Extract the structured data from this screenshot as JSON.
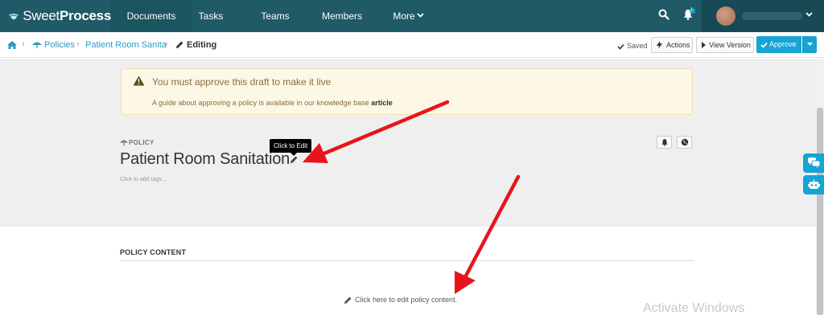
{
  "brand": {
    "sweet": "Sweet",
    "process": "Process"
  },
  "nav": {
    "documents": "Documents",
    "tasks": "Tasks",
    "teams": "Teams",
    "members": "Members",
    "more": "More",
    "notification_count": "1"
  },
  "breadcrumb": {
    "policies": "Policies",
    "document": "Patient Room Sanita",
    "current": "Editing"
  },
  "toolbar": {
    "saved": "Saved",
    "actions": "Actions",
    "view_version": "View Version",
    "approve": "Approve"
  },
  "alert": {
    "title": "You must approve this draft to make it live",
    "body": "A guide about approving a policy is available in our knowledge base",
    "link": "article"
  },
  "policy": {
    "label": "POLICY",
    "title": "Patient Room Sanitation",
    "tooltip": "Click to Edit",
    "tags_placeholder": "Click to add tags..."
  },
  "content": {
    "heading": "POLICY CONTENT",
    "edit_prompt": "Click here to edit policy content."
  },
  "watermark": "Activate Windows",
  "colors": {
    "topnav": "#1f5a66",
    "accent": "#16a4d4",
    "alert_bg": "#fcf8e5",
    "alert_text": "#8a6d3b",
    "annotation_arrow": "#e8141c"
  }
}
